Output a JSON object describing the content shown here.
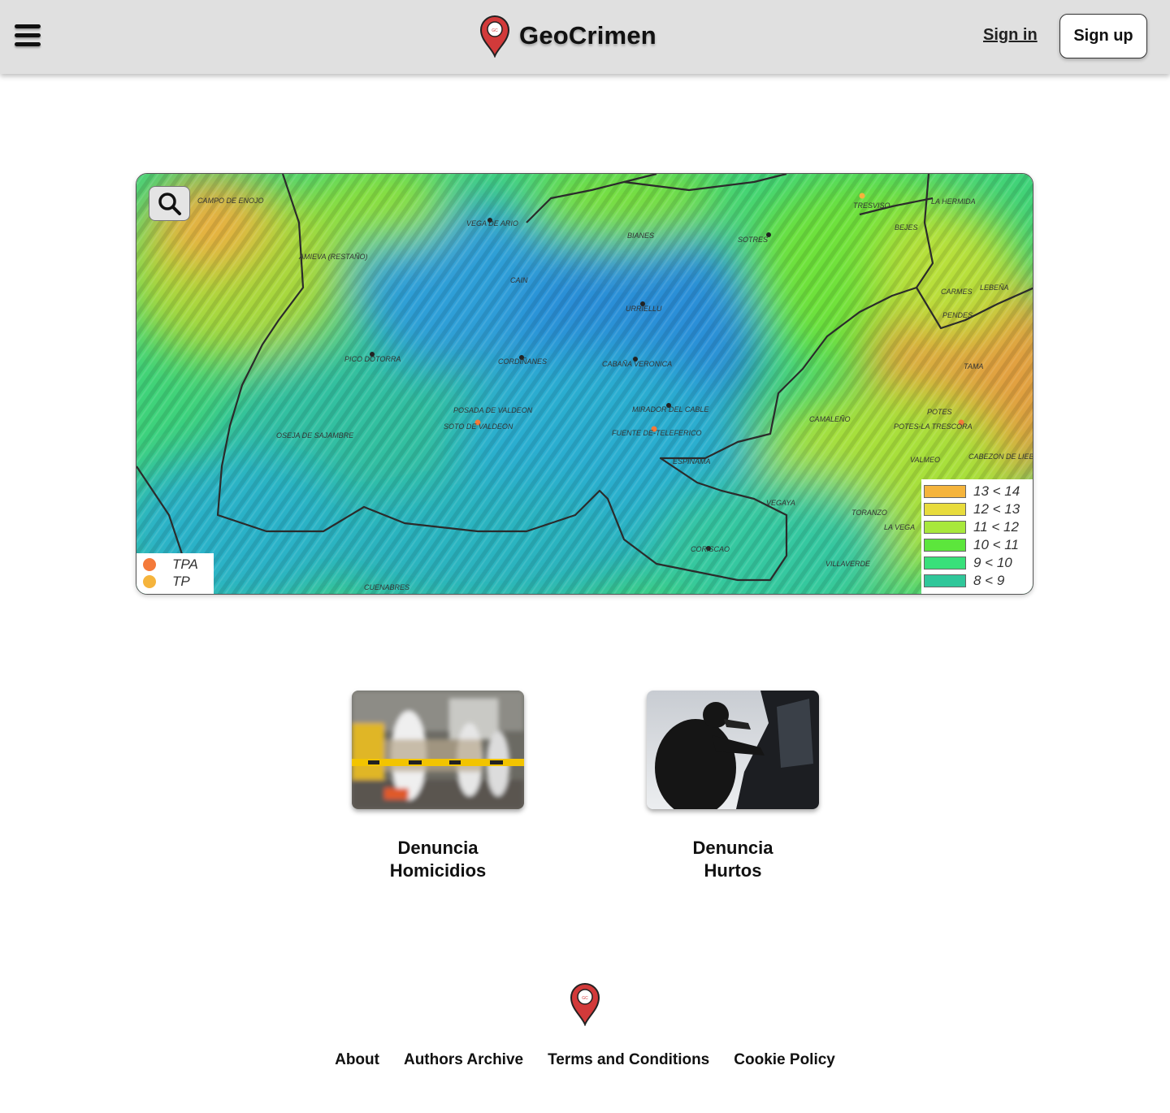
{
  "header": {
    "brand_name": "GeoCrimen",
    "sign_in": "Sign in",
    "sign_up": "Sign up"
  },
  "map": {
    "search_icon": "search-icon",
    "place_labels": [
      "CAMPO DE ENOJO",
      "VEGA DE ARIO",
      "BIANES",
      "SOTRES",
      "TRESVISO",
      "LA HERMIDA",
      "BEJES",
      "AMIEVA (RESTAÑO)",
      "CAIN",
      "URRIELLU",
      "CARMES",
      "LEBEÑA",
      "PENDES",
      "PICO DOTORRA",
      "CORDIÑANES",
      "CABAÑA VERONICA",
      "TAMA",
      "POSADA DE VALDEON",
      "SOTO DE VALDEON",
      "MIRADOR DEL CABLE",
      "FUENTE DE-TELEFERICO",
      "CAMALEÑO",
      "POTES",
      "POTES-LA TRESCORA",
      "OSEJA DE SAJAMBRE",
      "ESPINAMA",
      "VALMEO",
      "CABEZON DE LIEBANA",
      "VEGAYA",
      "TORANZO",
      "LA VEGA",
      "CORISCAO",
      "VILLAVERDE",
      "CUENABRES"
    ],
    "legend_ranges": [
      {
        "label": "13 < 14",
        "color": "#f5b43c"
      },
      {
        "label": "12 < 13",
        "color": "#e8dc3c"
      },
      {
        "label": "11 < 12",
        "color": "#a8e83c"
      },
      {
        "label": "10 < 11",
        "color": "#5ce63c"
      },
      {
        "label": "9 < 10",
        "color": "#38e07a"
      },
      {
        "label": "8 < 9",
        "color": "#30c79a"
      }
    ],
    "legend_points": [
      {
        "label": "TPA",
        "color": "#f47a3a"
      },
      {
        "label": "TP",
        "color": "#f5b43c"
      }
    ]
  },
  "cards": [
    {
      "title_line1": "Denuncia",
      "title_line2": "Homicidios"
    },
    {
      "title_line1": "Denuncia",
      "title_line2": "Hurtos"
    }
  ],
  "footer": {
    "links": [
      "About",
      "Authors Archive",
      "Terms and Conditions",
      "Cookie Policy"
    ]
  }
}
